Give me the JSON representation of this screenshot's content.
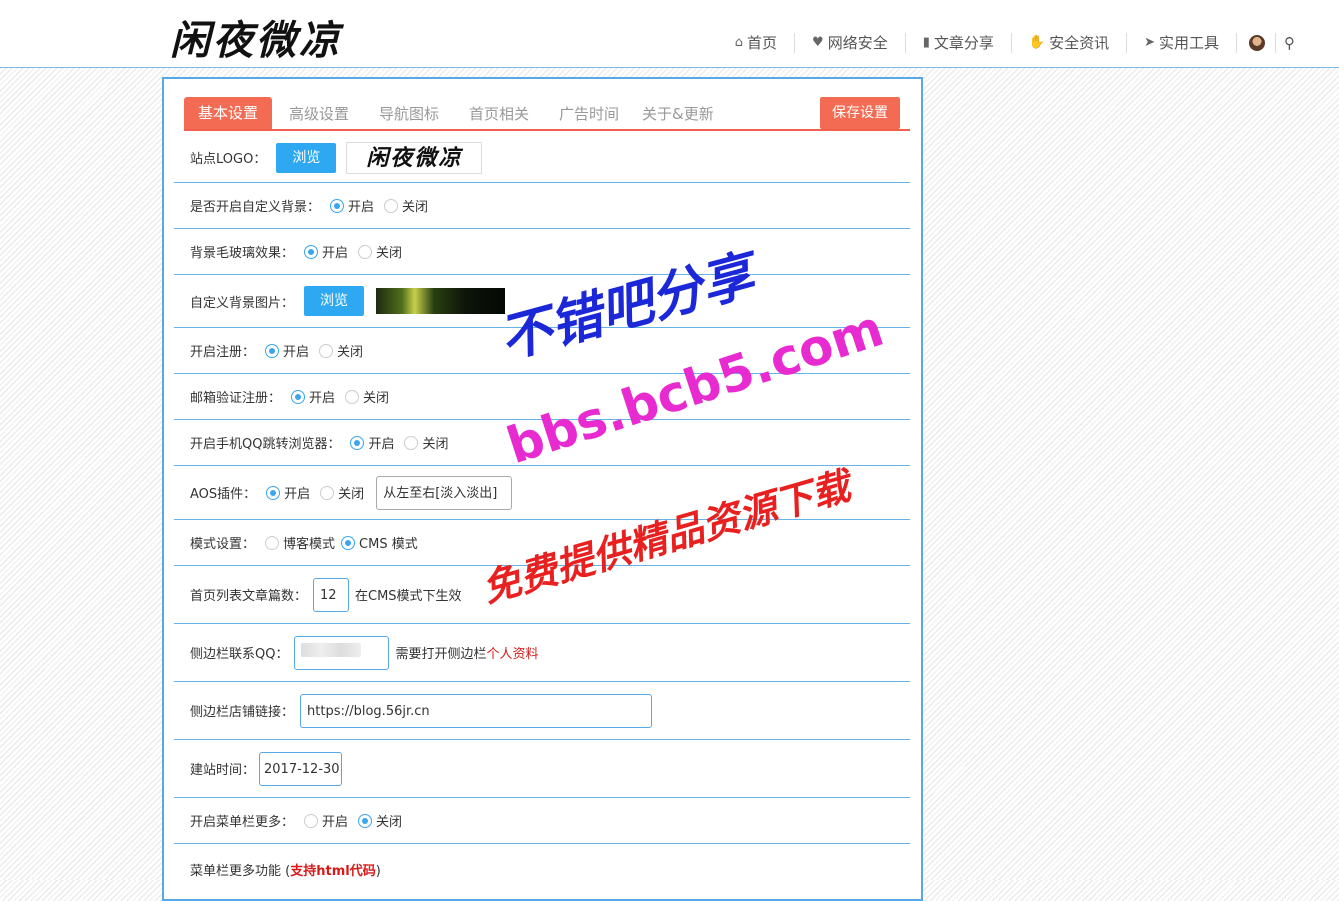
{
  "header": {
    "logo_text": "闲夜微凉",
    "nav": [
      {
        "icon": "home-icon",
        "glyph": "⌂",
        "label": "首页"
      },
      {
        "icon": "heartbeat-icon",
        "glyph": "♥",
        "label": "网络安全"
      },
      {
        "icon": "book-icon",
        "glyph": "▮",
        "label": "文章分享"
      },
      {
        "icon": "handshake-icon",
        "glyph": "✋",
        "label": "安全资讯"
      },
      {
        "icon": "telegram-icon",
        "glyph": "➤",
        "label": "实用工具"
      }
    ],
    "search_glyph": "⚲"
  },
  "tabs": {
    "items": [
      "基本设置",
      "高级设置",
      "导航图标",
      "首页相关",
      "广告时间",
      "关于&更新"
    ],
    "save": "保存设置"
  },
  "form": {
    "logo": {
      "label": "站点LOGO：",
      "button": "浏览",
      "thumb_text": "闲夜微凉"
    },
    "custom_bg": {
      "label": "是否开启自定义背景：",
      "on": "开启",
      "off": "关闭",
      "selected": "on"
    },
    "frosted": {
      "label": "背景毛玻璃效果：",
      "on": "开启",
      "off": "关闭",
      "selected": "on"
    },
    "bg_image": {
      "label": "自定义背景图片：",
      "button": "浏览"
    },
    "register": {
      "label": "开启注册：",
      "on": "开启",
      "off": "关闭",
      "selected": "on"
    },
    "email_verify": {
      "label": "邮箱验证注册：",
      "on": "开启",
      "off": "关闭",
      "selected": "on"
    },
    "qq_browser": {
      "label": "开启手机QQ跳转浏览器：",
      "on": "开启",
      "off": "关闭",
      "selected": "on"
    },
    "aos": {
      "label": "AOS插件：",
      "on": "开启",
      "off": "关闭",
      "selected": "on",
      "effect": "从左至右[淡入淡出]"
    },
    "mode": {
      "label": "模式设置：",
      "blog": "博客模式",
      "cms": "CMS 模式",
      "selected": "cms"
    },
    "list_count": {
      "label": "首页列表文章篇数：",
      "value": "12",
      "note": "在CMS模式下生效"
    },
    "sidebar_qq": {
      "label": "侧边栏联系QQ：",
      "note": "需要打开侧边栏",
      "link": "个人资料"
    },
    "shop_link": {
      "label": "侧边栏店铺链接：",
      "value": "https://blog.56jr.cn"
    },
    "build_time": {
      "label": "建站时间：",
      "value": "2017-12-30"
    },
    "menu_more": {
      "label": "开启菜单栏更多：",
      "on": "开启",
      "off": "关闭",
      "selected": "off"
    },
    "menu_more_func": {
      "label": "菜单栏更多功能 (",
      "highlight": "支持html代码",
      "suffix": ")"
    }
  },
  "watermarks": {
    "line1": "不错吧分享",
    "line2": "bbs.bcb5.com",
    "line3": "免费提供精品资源下载"
  }
}
